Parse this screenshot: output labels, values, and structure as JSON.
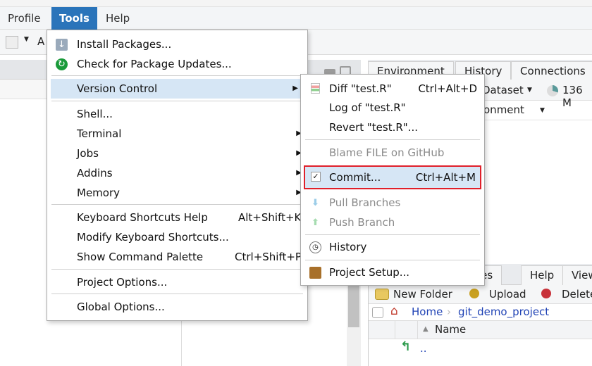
{
  "menubar": {
    "items": [
      "Profile",
      "Tools",
      "Help"
    ],
    "active": "Tools"
  },
  "toolbar": {
    "addins_partial": "A"
  },
  "env_pane": {
    "tabs": [
      "Environment",
      "History",
      "Connections"
    ],
    "import_partial": "Dataset",
    "memory": "136 M",
    "env_partial": "ironment"
  },
  "files_pane": {
    "tabs_partial": [
      "kages",
      "Help",
      "View"
    ],
    "new_folder": "New Folder",
    "upload": "Upload",
    "delete_partial": "Delete",
    "breadcrumb": [
      "Home",
      "git_demo_project"
    ],
    "column_name": "Name",
    "parent_dir": ".."
  },
  "tools_menu": {
    "items": [
      {
        "label": "Install Packages...",
        "icon": "install-icon"
      },
      {
        "label": "Check for Package Updates...",
        "icon": "refresh-icon"
      },
      {
        "label": "Version Control",
        "submenu": true,
        "highlighted": true
      },
      {
        "label": "Shell..."
      },
      {
        "label": "Terminal",
        "submenu": true
      },
      {
        "label": "Jobs",
        "submenu": true
      },
      {
        "label": "Addins",
        "submenu": true
      },
      {
        "label": "Memory",
        "submenu": true
      },
      {
        "label": "Keyboard Shortcuts Help",
        "shortcut": "Alt+Shift+K"
      },
      {
        "label": "Modify Keyboard Shortcuts..."
      },
      {
        "label": "Show Command Palette",
        "shortcut": "Ctrl+Shift+P"
      },
      {
        "label": "Project Options..."
      },
      {
        "label": "Global Options..."
      }
    ]
  },
  "vc_menu": {
    "items": [
      {
        "label": "Diff \"test.R\"",
        "shortcut": "Ctrl+Alt+D"
      },
      {
        "label": "Log of \"test.R\""
      },
      {
        "label": "Revert \"test.R\"..."
      },
      {
        "label": "Blame FILE on GitHub",
        "disabled": true
      },
      {
        "label": "Commit...",
        "shortcut": "Ctrl+Alt+M",
        "highlighted": true
      },
      {
        "label": "Pull Branches",
        "disabled": true
      },
      {
        "label": "Push Branch",
        "disabled": true
      },
      {
        "label": "History"
      },
      {
        "label": "Project Setup..."
      }
    ]
  },
  "colors": {
    "accent": "#2a74ba",
    "highlight": "#d6e6f5",
    "commit_outline": "#e0202a"
  }
}
